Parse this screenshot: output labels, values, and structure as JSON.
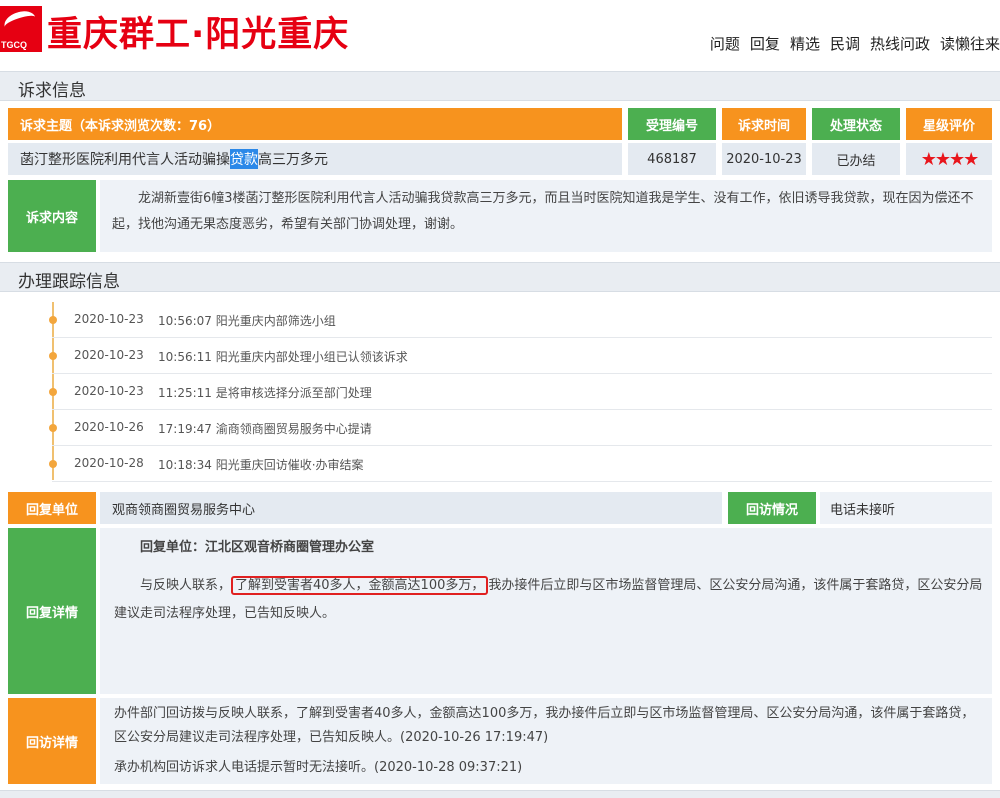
{
  "header": {
    "logo_text": "TGCQ",
    "site_title": "重庆群工·阳光重庆",
    "nav": [
      "问题",
      "回复",
      "精选",
      "民调",
      "热线问政",
      "读懒往来"
    ]
  },
  "appeal_section": {
    "title": "诉求信息",
    "subject_header": "诉求主题（本诉求浏览次数：76）",
    "col_headers": [
      "受理编号",
      "诉求时间",
      "处理状态",
      "星级评价"
    ],
    "subject_pre": "菡汀整形医院利用代言人活动骗操",
    "subject_highlight": "贷款",
    "subject_post": "高三万多元",
    "ticket_no": "468187",
    "date": "2020-10-23",
    "status": "已办结",
    "stars": "★★★★",
    "content_label": "诉求内容",
    "content_text": "龙湖新壹街6幢3楼菡汀整形医院利用代言人活动骗我贷款高三万多元，而且当时医院知道我是学生、没有工作，依旧诱导我贷款，现在因为偿还不起，找他沟通无果态度恶劣，希望有关部门协调处理，谢谢。"
  },
  "tracking_section": {
    "title": "办理跟踪信息",
    "rows": [
      {
        "date": "2020-10-23",
        "text": "10:56:07 阳光重庆内部筛选小组"
      },
      {
        "date": "2020-10-23",
        "text": "10:56:11 阳光重庆内部处理小组已认领该诉求"
      },
      {
        "date": "2020-10-23",
        "text": "11:25:11 是将审核选择分派至部门处理"
      },
      {
        "date": "2020-10-26",
        "text": "17:19:47 渝商领商圈贸易服务中心提请"
      },
      {
        "date": "2020-10-28",
        "text": "10:18:34 阳光重庆回访催收·办审结案"
      }
    ]
  },
  "reply_section": {
    "unit_label": "回复单位",
    "unit_name": "观商领商圈贸易服务中心",
    "visit_label": "回访情况",
    "visit_value": "电话未接听",
    "detail_label": "回复详情",
    "reply_unit_line": "回复单位：江北区观音桥商圈管理办公室",
    "reply_pre": "与反映人联系，",
    "reply_boxed": "了解到受害者40多人，金额高达100多万，",
    "reply_post": "我办接件后立即与区市场监督管理局、区公安分局沟通，该件属于套路贷，区公安分局建议走司法程序处理，已告知反映人。",
    "followup_label": "回访详情",
    "followup_text": "办件部门回访拨与反映人联系，了解到受害者40多人，金额高达100多万，我办接件后立即与区市场监督管理局、区公安分局沟通，该件属于套路贷，区公安分局建议走司法程序处理，已告知反映人。(2020-10-26 17:19:47)",
    "followup_text2": "承办机构回访诉求人电话提示暂时无法接听。(2020-10-28 09:37:21)"
  },
  "colors": {
    "brand_red": "#e60012",
    "orange": "#f7931e",
    "green": "#4caf50",
    "highlight_blue": "#2b88e8"
  }
}
